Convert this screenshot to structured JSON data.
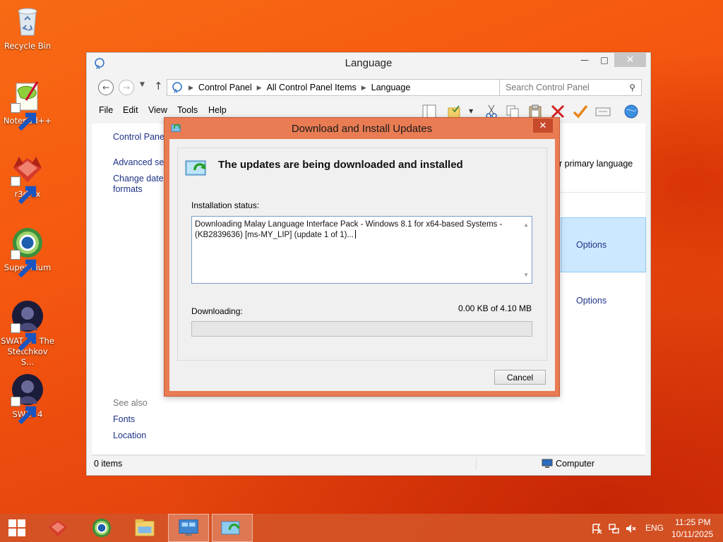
{
  "desktop": {
    "icons": [
      {
        "label": "Recycle Bin"
      },
      {
        "label": "Notepad++"
      },
      {
        "label": "r3dfox"
      },
      {
        "label": "Supermium"
      },
      {
        "label": "SWAT 4 - The Stetchkov S..."
      },
      {
        "label": "SWAT 4"
      }
    ]
  },
  "explorer": {
    "title": "Language",
    "breadcrumbs": [
      "Control Panel",
      "All Control Panel Items",
      "Language"
    ],
    "search_placeholder": "Search Control Panel",
    "menu": [
      "File",
      "Edit",
      "View",
      "Tools",
      "Help"
    ],
    "left_links": [
      "Control Panel",
      "Advanced sett",
      "Change date,",
      "formats"
    ],
    "see_also_heading": "See also",
    "see_also_links": [
      "Fonts",
      "Location"
    ],
    "right_text": "r primary language",
    "options_links": [
      "Options",
      "Options"
    ],
    "status_count": "0 items",
    "status_computer": "Computer"
  },
  "dialog": {
    "title": "Download and Install Updates",
    "heading": "The updates are being downloaded and installed",
    "installation_status_label": "Installation status:",
    "status_text": "Downloading Malay Language Interface Pack - Windows 8.1 for x64-based Systems - (KB2839636) [ms-MY_LIP] (update 1 of 1)...",
    "downloading_label": "Downloading:",
    "download_size": "0.00 KB of 4.10 MB",
    "progress": 0,
    "cancel_label": "Cancel"
  },
  "taskbar": {
    "language": "ENG",
    "time": "11:25 PM",
    "date": "10/11/2025"
  }
}
